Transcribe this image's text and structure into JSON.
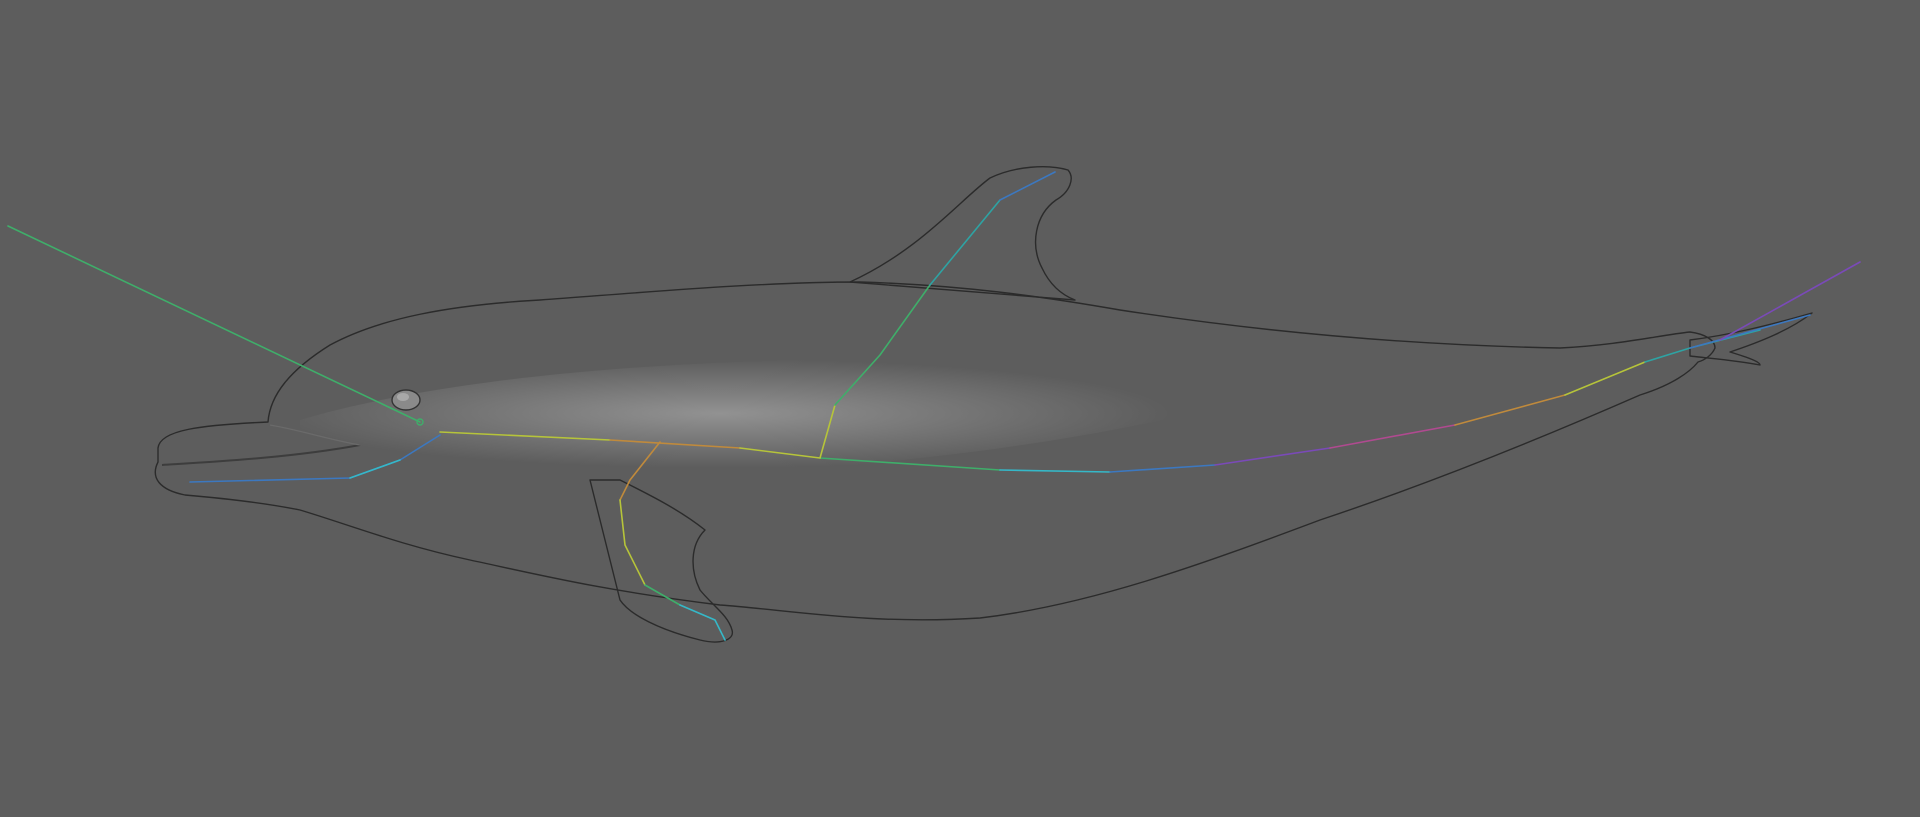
{
  "viewport": {
    "background": "#5d5d5d",
    "subject": "dolphin-mesh",
    "mesh_shading": "smooth-gray"
  },
  "rig": {
    "bone_colors": {
      "green": "#3fae6a",
      "teal": "#2ea3a3",
      "cyan": "#35b8c8",
      "blue": "#3c78c0",
      "yellow": "#b6c43a",
      "orange": "#c08a3c",
      "magenta": "#b04a90",
      "purple": "#7a4ab8"
    }
  },
  "colors": {
    "mesh_light": "#b0b0b0",
    "mesh_mid": "#8a8a8a",
    "mesh_dark": "#505050"
  }
}
